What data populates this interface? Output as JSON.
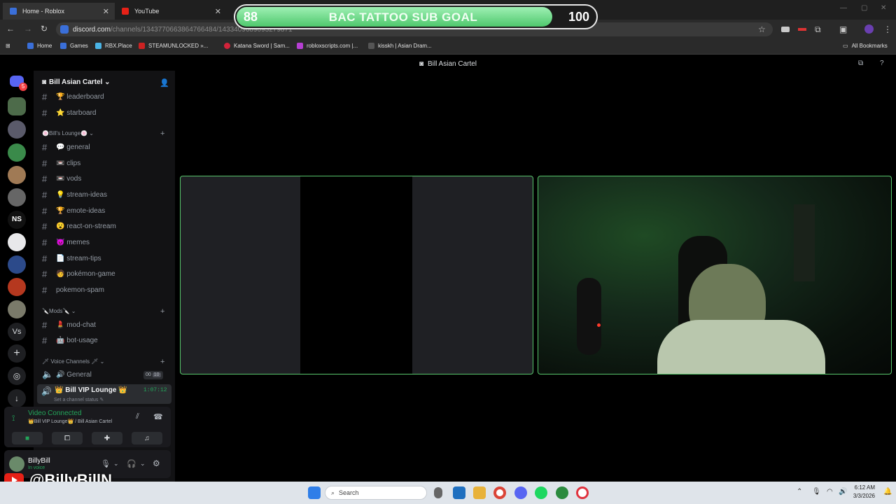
{
  "browser": {
    "tabs": [
      {
        "label": "Home - Roblox"
      },
      {
        "label": "YouTube"
      }
    ],
    "url_main": "discord.com",
    "url_path": "/channels/1343770663864766484/1433409689093279871",
    "bookmarks": [
      "Home",
      "Games",
      "RBX.Place",
      "STEAMUNLOCKED »...",
      "Katana Sword | Sam...",
      "robloxscripts.com |...",
      "kisskh | Asian Dram..."
    ],
    "all_bookmarks": "All Bookmarks"
  },
  "overlay": {
    "low": "88",
    "title": "BAC TATTOO SUB GOAL",
    "high": "100",
    "progress": 0.88
  },
  "discord": {
    "window_title": "Bill Asian Cartel",
    "server_name": "Bill Asian Cartel",
    "guild_badge": "5",
    "guild_labels": {
      "ns": "NS",
      "vs": "Vs"
    },
    "channels_top": [
      {
        "label": "🏆 leaderboard"
      },
      {
        "label": "⭐ starboard"
      }
    ],
    "cat_lounge": "🍥Bill's Lounge🍥",
    "lounge": [
      {
        "label": "💬 general"
      },
      {
        "label": "📼 clips"
      },
      {
        "label": "📼 vods"
      },
      {
        "label": "💡 stream-ideas"
      },
      {
        "label": "🏆 emote-ideas"
      },
      {
        "label": "😮 react-on-stream"
      },
      {
        "label": "😈 memes"
      },
      {
        "label": "📄 stream-tips"
      },
      {
        "label": "🧑 pokémon-game"
      },
      {
        "label": "pokemon-spam"
      }
    ],
    "cat_mods": "🔪Mods🔪",
    "mods": [
      {
        "label": "💄 mod-chat"
      },
      {
        "label": "🤖 bot-usage"
      }
    ],
    "cat_voice": "🗡 Voice Channels 🗡",
    "voice_general": "🔊 General",
    "voice_general_counts": [
      "00",
      "10"
    ],
    "voice_active": "👑 Bill VIP Lounge 👑",
    "voice_timer": "1:07:12",
    "channel_status": "Set a channel status",
    "vc_status": "Video Connected",
    "vc_location": "👑Bill VIP Lounge👑 / Bill Asian Cartel",
    "username": "BillyBill",
    "user_status": "In voice"
  },
  "watermark": "@BillyBillN",
  "taskbar": {
    "search": "Search",
    "time": "6:12 AM",
    "date": "3/3/2026"
  },
  "colors": {
    "accent_green": "#57c56b",
    "discord_bg": "#121214",
    "link_blue": "#00a8fc"
  }
}
